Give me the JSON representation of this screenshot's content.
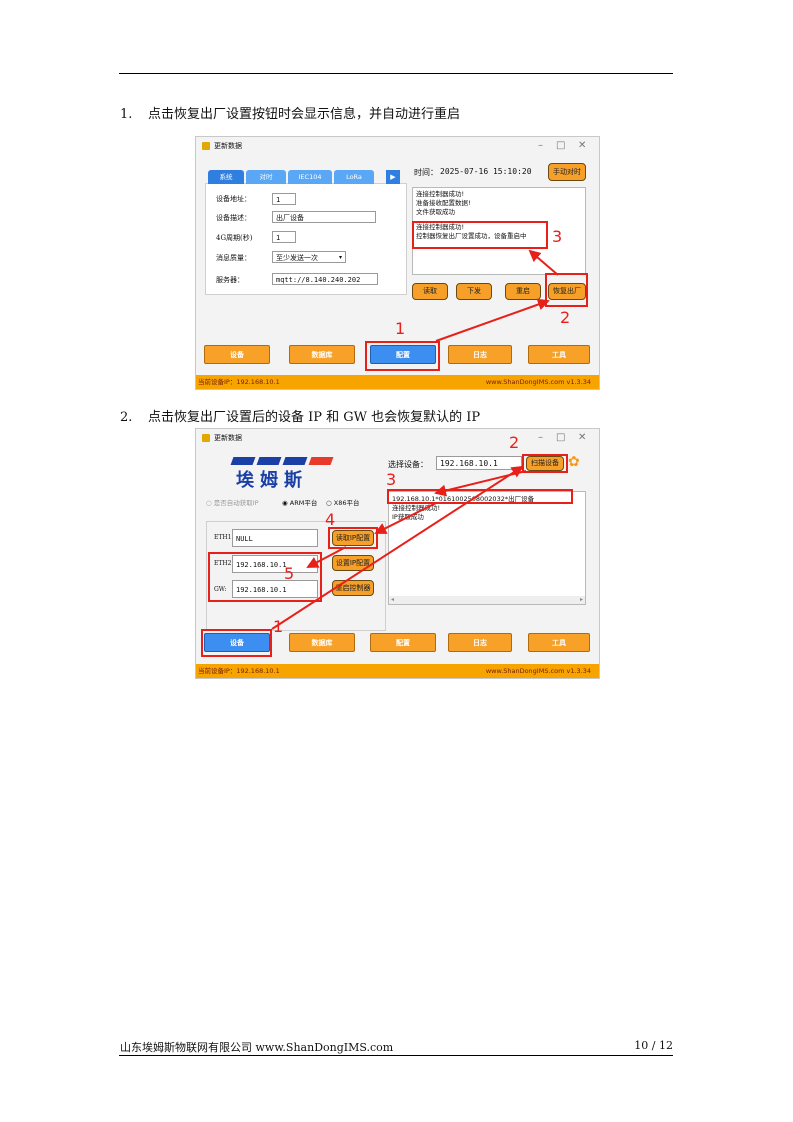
{
  "steps": [
    {
      "num": "1.",
      "text": "点击恢复出厂设置按钮时会显示信息，并自动进行重启"
    },
    {
      "num": "2.",
      "text": "点击恢复出厂设置后的设备 IP 和 GW 也会恢复默认的 IP"
    }
  ],
  "shot1": {
    "window_title": "更新数据",
    "tabs": [
      "系统",
      "对时",
      "IEC104",
      "LoRa"
    ],
    "time_label": "时间：",
    "time_value": "2025-07-16 15:10:20",
    "manual_time_button": "手动对时",
    "fields": [
      {
        "label": "设备地址：",
        "value": "1"
      },
      {
        "label": "设备描述：",
        "value": "出厂设备"
      },
      {
        "label": "4G周期(秒)",
        "value": "1"
      },
      {
        "label": "消息质量：",
        "value": "至少发送一次"
      },
      {
        "label": "服务器：",
        "value": "mqtt://8.140.240.202"
      }
    ],
    "log_lines": [
      "连接控制器成功!",
      "准备接收配置数据!",
      "文件获取成功"
    ],
    "log_highlight": [
      "连接控制器成功!",
      "控制器恢复出厂设置成功，设备重启中"
    ],
    "buttons": [
      "读取",
      "下发",
      "重启",
      "恢复出厂"
    ],
    "nav": [
      "设备",
      "数据库",
      "配置",
      "日志",
      "工具"
    ],
    "status_left": "当前设备IP：192.168.10.1",
    "status_right": "www.ShanDongIMS.com   v1.3.34",
    "markers": [
      "1",
      "2",
      "3"
    ]
  },
  "shot2": {
    "window_title": "更新数据",
    "logo_text": "埃姆斯",
    "select_label": "选择设备：",
    "select_value": "192.168.10.1",
    "scan_button": "扫描设备",
    "radios": [
      "是否自动获取IP",
      "ARM平台",
      "X86平台"
    ],
    "fields": [
      {
        "label": "ETH1",
        "value": "NULL"
      },
      {
        "label": "ETH2",
        "value": "192.168.10.1"
      },
      {
        "label": "GW:",
        "value": "192.168.10.1"
      }
    ],
    "buttons": [
      "读取IP配置",
      "设置IP配置",
      "重启控制器"
    ],
    "list_lines": [
      "192.168.10.1*0161002508002032*出厂设备",
      "连接控制器成功!",
      "IP获取成功"
    ],
    "nav": [
      "设备",
      "数据库",
      "配置",
      "日志",
      "工具"
    ],
    "status_left": "当前设备IP：192.168.10.1",
    "status_right": "www.ShanDongIMS.com   v1.3.34",
    "markers": [
      "1",
      "2",
      "3",
      "4",
      "5"
    ]
  },
  "footer": {
    "left": "山东埃姆斯物联网有限公司 www.ShanDongIMS.com",
    "right": "10 / 12"
  }
}
